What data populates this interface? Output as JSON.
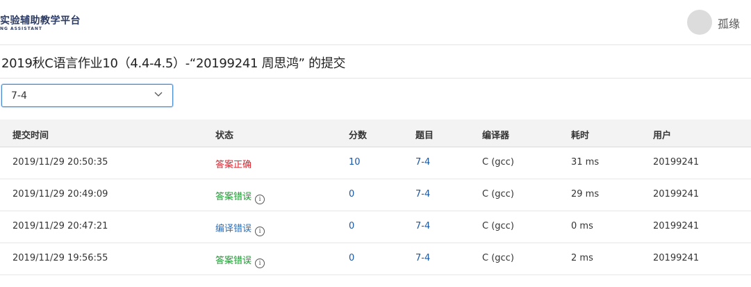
{
  "header": {
    "logo_title": "实验辅助教学平台",
    "logo_subtitle": "NG ASSISTANT",
    "username": "孤缘"
  },
  "page": {
    "title": "2019秋C语言作业10（4.4-4.5）-“20199241 周思鸿” 的提交"
  },
  "filter": {
    "selected": "7-4",
    "icon": "chevron-down-icon"
  },
  "table": {
    "headers": {
      "time": "提交时间",
      "status": "状态",
      "score": "分数",
      "problem": "题目",
      "compiler": "编译器",
      "cost": "耗时",
      "user": "用户"
    },
    "rows": [
      {
        "time": "2019/11/29 20:50:35",
        "status": "答案正确",
        "score": "10",
        "problem": "7-4",
        "compiler": "C (gcc)",
        "cost": "31 ms",
        "user": "20199241"
      },
      {
        "time": "2019/11/29 20:49:09",
        "status": "答案错误",
        "score": "0",
        "problem": "7-4",
        "compiler": "C (gcc)",
        "cost": "29 ms",
        "user": "20199241"
      },
      {
        "time": "2019/11/29 20:47:21",
        "status": "编译错误",
        "score": "0",
        "problem": "7-4",
        "compiler": "C (gcc)",
        "cost": "0 ms",
        "user": "20199241"
      },
      {
        "time": "2019/11/29 19:56:55",
        "status": "答案错误",
        "score": "0",
        "problem": "7-4",
        "compiler": "C (gcc)",
        "cost": "2 ms",
        "user": "20199241"
      }
    ],
    "info_icon": "i"
  },
  "colors": {
    "accepted": "#d9232d",
    "wrong_answer": "#1c9a30",
    "compile_error": "#2e6fb8",
    "link": "#1a57a6"
  }
}
